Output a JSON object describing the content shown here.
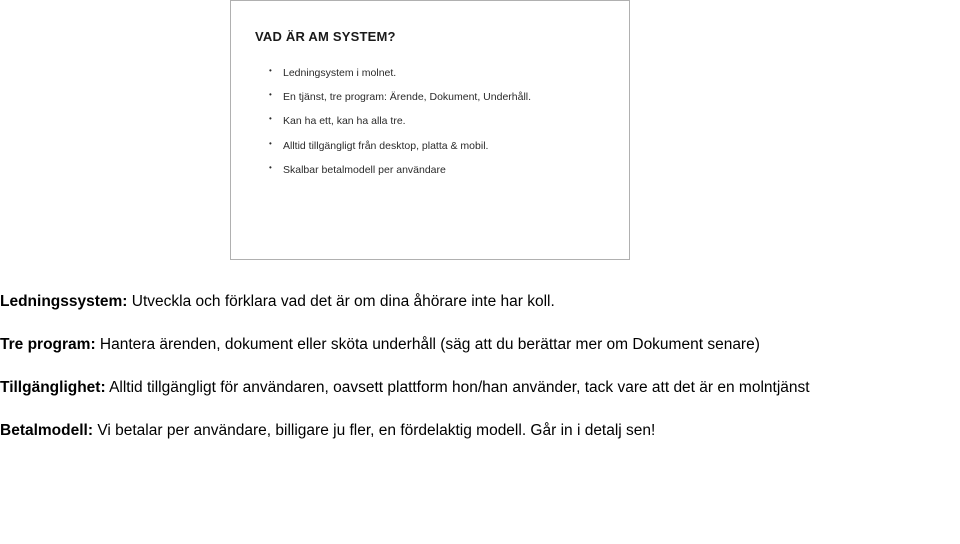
{
  "slide": {
    "title": "VAD ÄR AM SYSTEM?",
    "bullets": [
      "Ledningsystem i molnet.",
      "En tjänst, tre program: Ärende, Dokument, Underhåll.",
      "Kan ha ett, kan ha alla tre.",
      "Alltid tillgängligt från desktop, platta & mobil.",
      "Skalbar betalmodell per användare"
    ]
  },
  "notes": [
    {
      "bold": "Ledningssystem:",
      "text": " Utveckla och förklara vad det är om dina åhörare inte har koll."
    },
    {
      "bold": "Tre program:",
      "text": " Hantera ärenden, dokument eller sköta underhåll (säg att du berättar mer om Dokument senare)"
    },
    {
      "bold": "Tillgänglighet:",
      "text": " Alltid tillgängligt för användaren, oavsett plattform hon/han använder, tack vare att det är en molntjänst"
    },
    {
      "bold": "Betalmodell:",
      "text": " Vi betalar per användare, billigare ju fler, en fördelaktig modell. Går in i detalj sen!"
    }
  ]
}
